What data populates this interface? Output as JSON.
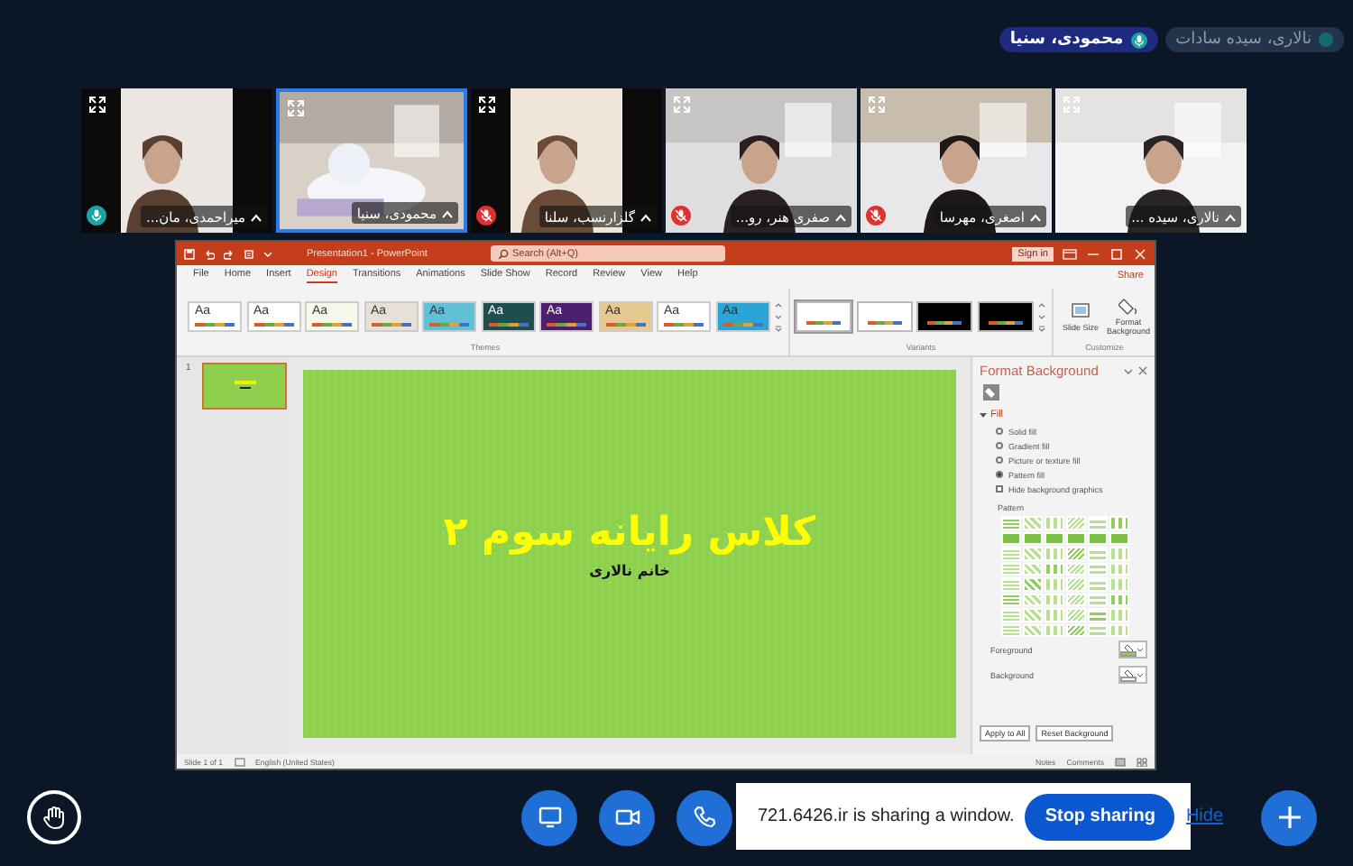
{
  "chips": [
    {
      "name": "نالاری، سیده سادات",
      "talking": false
    },
    {
      "name": "محمودی، سنیا",
      "talking": true
    }
  ],
  "tiles": [
    {
      "name": "نالاری، سیده ...",
      "selected": false,
      "muted": false,
      "talking": false
    },
    {
      "name": "اصغری، مهرسا",
      "selected": false,
      "muted": true,
      "talking": false
    },
    {
      "name": "صفری هنر، رو...",
      "selected": false,
      "muted": true,
      "talking": false
    },
    {
      "name": "گلزارنسب، سلنا",
      "selected": false,
      "muted": true,
      "talking": false
    },
    {
      "name": "محمودی، سنیا",
      "selected": true,
      "muted": false,
      "talking": false
    },
    {
      "name": "میراحمدی، مان...",
      "selected": false,
      "muted": false,
      "talking": true
    }
  ],
  "shared_window": {
    "title": "Presentation1 - PowerPoint",
    "search": {
      "placeholder": "Search (Alt+Q)"
    },
    "sign_in": "Sign in",
    "tabs": [
      {
        "label": "File",
        "selected": false
      },
      {
        "label": "Home",
        "selected": false
      },
      {
        "label": "Insert",
        "selected": false
      },
      {
        "label": "Design",
        "selected": true
      },
      {
        "label": "Transitions",
        "selected": false
      },
      {
        "label": "Animations",
        "selected": false
      },
      {
        "label": "Slide Show",
        "selected": false
      },
      {
        "label": "Record",
        "selected": false
      },
      {
        "label": "Review",
        "selected": false
      },
      {
        "label": "View",
        "selected": false
      },
      {
        "label": "Help",
        "selected": false
      }
    ],
    "share": "Share",
    "themes": [
      {
        "label": "Aa",
        "color": "#ffffff"
      },
      {
        "label": "Aa",
        "color": "#ffffff"
      },
      {
        "label": "Aa",
        "color": "#f4f9ec"
      },
      {
        "label": "Aa",
        "color": "#e6e0d6"
      },
      {
        "label": "Aa",
        "color": "#5fc0d8"
      },
      {
        "label": "Aa",
        "color": "#1f4e4f"
      },
      {
        "label": "Aa",
        "color": "#4a1f6b"
      },
      {
        "label": "Aa",
        "color": "#e7c88e"
      },
      {
        "label": "Aa",
        "color": "#ffffff"
      },
      {
        "label": "Aa",
        "color": "#2ba5d6"
      }
    ],
    "variants": [
      {
        "color": "#ffffff",
        "selected": true
      },
      {
        "color": "#ffffff",
        "selected": false
      },
      {
        "color": "#000000",
        "selected": false
      },
      {
        "color": "#000000",
        "selected": false
      }
    ],
    "customize_buttons": [
      "Slide Size",
      "Format Background"
    ],
    "group_labels": [
      "Themes",
      "Variants",
      "Customize"
    ],
    "slide_number": "1",
    "slide": {
      "title": "کلاس رایانه سوم ۲",
      "subtitle": "خانم نالاری"
    },
    "pane": {
      "title": "Format Background",
      "section": {
        "label": "Fill",
        "expanded": true
      },
      "options": [
        {
          "kind": "radio",
          "label": "Solid fill",
          "selected": false
        },
        {
          "kind": "radio",
          "label": "Gradient fill",
          "selected": false
        },
        {
          "kind": "radio",
          "label": "Picture or texture fill",
          "selected": false
        },
        {
          "kind": "radio",
          "label": "Pattern fill",
          "selected": true
        },
        {
          "kind": "checkbox",
          "label": "Hide background graphics",
          "checked": false
        }
      ],
      "pattern_label": "Pattern",
      "colors": [
        {
          "label": "Foreground",
          "color": "#8dd14f"
        },
        {
          "label": "Background",
          "color": "#ffffff"
        }
      ],
      "buttons": [
        "Apply to All",
        "Reset Background"
      ]
    },
    "status_bar": {
      "slide": "Slide 1 of 1",
      "language": "English (United States)",
      "notes": "Notes",
      "comments": "Comments"
    }
  },
  "share_bar": {
    "notice": "721.6426.ir is sharing a window.",
    "stop_button": "Stop sharing",
    "hide_link": "Hide"
  }
}
